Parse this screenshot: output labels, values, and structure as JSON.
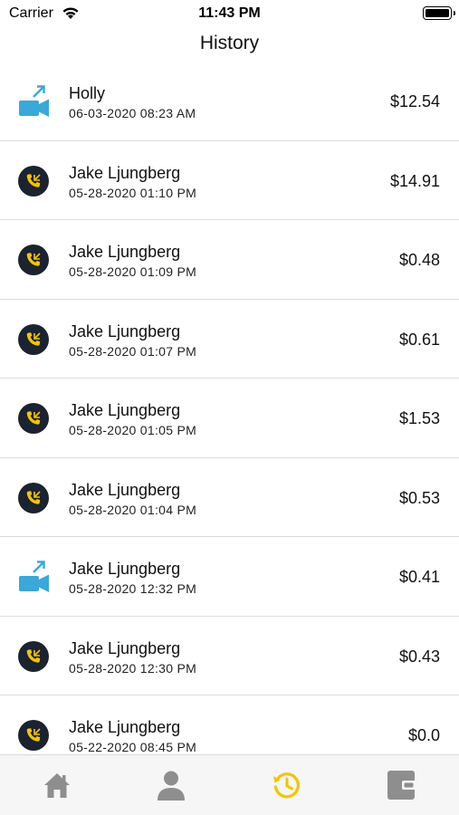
{
  "status": {
    "carrier": "Carrier",
    "time": "11:43 PM"
  },
  "nav": {
    "title": "History"
  },
  "history": [
    {
      "type": "video",
      "name": "Holly",
      "date": "06-03-2020 08:23 AM",
      "amount": "$12.54"
    },
    {
      "type": "call",
      "name": "Jake Ljungberg",
      "date": "05-28-2020 01:10 PM",
      "amount": "$14.91"
    },
    {
      "type": "call",
      "name": "Jake Ljungberg",
      "date": "05-28-2020 01:09 PM",
      "amount": "$0.48"
    },
    {
      "type": "call",
      "name": "Jake Ljungberg",
      "date": "05-28-2020 01:07 PM",
      "amount": "$0.61"
    },
    {
      "type": "call",
      "name": "Jake Ljungberg",
      "date": "05-28-2020 01:05 PM",
      "amount": "$1.53"
    },
    {
      "type": "call",
      "name": "Jake Ljungberg",
      "date": "05-28-2020 01:04 PM",
      "amount": "$0.53"
    },
    {
      "type": "video",
      "name": "Jake Ljungberg",
      "date": "05-28-2020 12:32 PM",
      "amount": "$0.41"
    },
    {
      "type": "call",
      "name": "Jake Ljungberg",
      "date": "05-28-2020 12:30 PM",
      "amount": "$0.43"
    },
    {
      "type": "call",
      "name": "Jake Ljungberg",
      "date": "05-22-2020 08:45 PM",
      "amount": "$0.0"
    }
  ],
  "tabs": [
    {
      "id": "home",
      "icon": "home-icon",
      "active": false
    },
    {
      "id": "profile",
      "icon": "person-icon",
      "active": false
    },
    {
      "id": "history",
      "icon": "history-icon",
      "active": true
    },
    {
      "id": "wallet",
      "icon": "wallet-icon",
      "active": false
    }
  ],
  "colors": {
    "accent": "#f5c400",
    "video": "#3aa8d8",
    "call_bg": "#1b2230",
    "tab_inactive": "#8e8e8e"
  }
}
